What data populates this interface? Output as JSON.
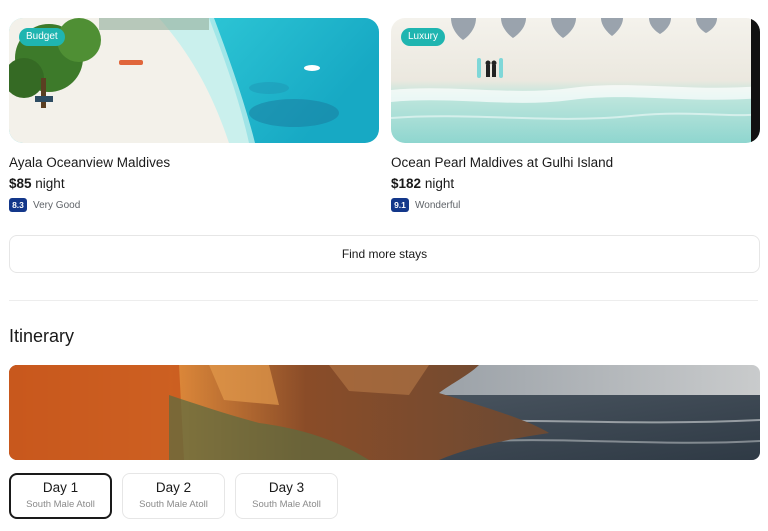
{
  "stays": [
    {
      "tag": "Budget",
      "name": "Ayala Oceanview Maldives",
      "price": "$85",
      "price_unit": "night",
      "score": "8.3",
      "rating_label": "Very Good"
    },
    {
      "tag": "Luxury",
      "name": "Ocean Pearl Maldives at Gulhi Island",
      "price": "$182",
      "price_unit": "night",
      "score": "9.1",
      "rating_label": "Wonderful"
    }
  ],
  "find_more_label": "Find more stays",
  "itinerary": {
    "title": "Itinerary",
    "days": [
      {
        "label": "Day 1",
        "location": "South Male Atoll",
        "selected": true
      },
      {
        "label": "Day 2",
        "location": "South Male Atoll",
        "selected": false
      },
      {
        "label": "Day 3",
        "location": "South Male Atoll",
        "selected": false
      }
    ]
  },
  "colors": {
    "tag_bg": "#1fb5b0",
    "score_bg": "#13378a",
    "selected_border": "#1a1a1a"
  }
}
